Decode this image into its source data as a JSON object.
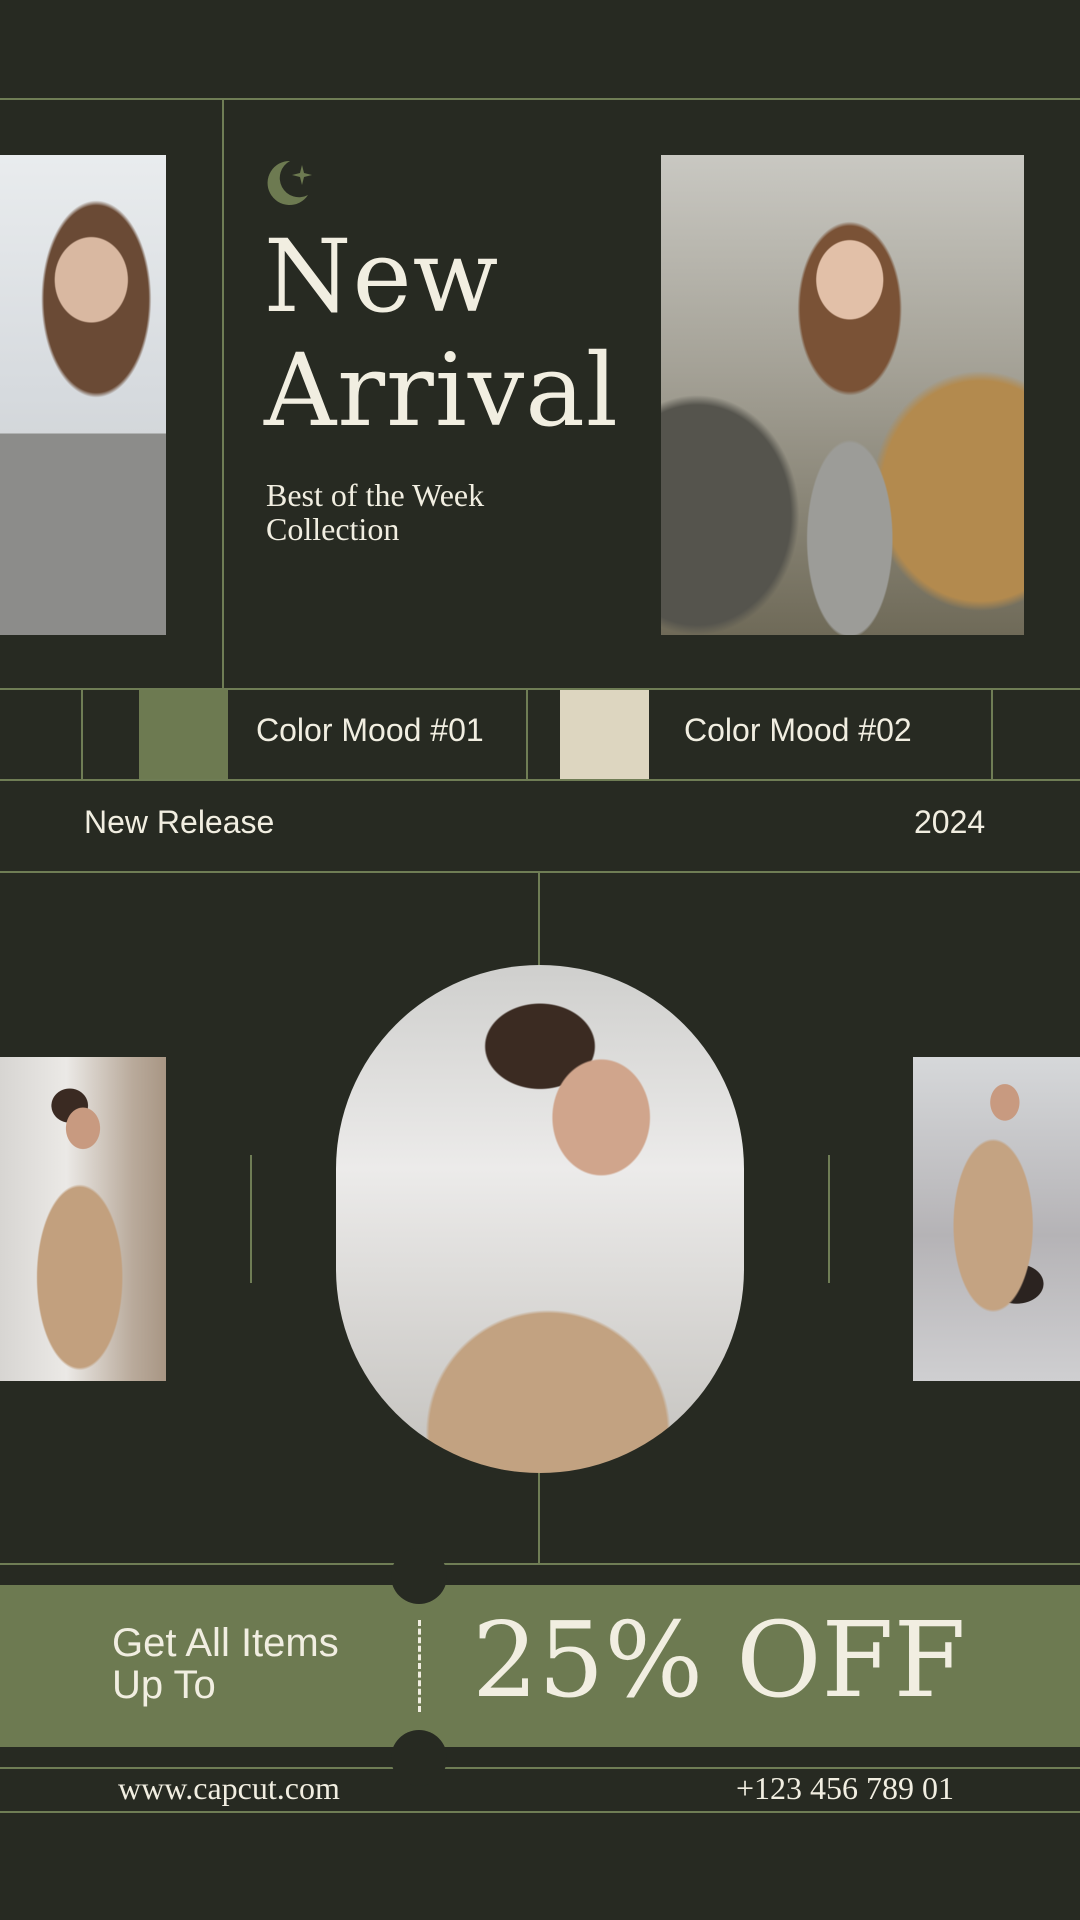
{
  "hero": {
    "title_line1": "New",
    "title_line2": "Arrival",
    "subtitle_line1": "Best of the Week",
    "subtitle_line2": "Collection",
    "logo_icon": "moon-star-icon"
  },
  "color_moods": [
    {
      "label": "Color Mood #01",
      "swatch": "#6d7a51"
    },
    {
      "label": "Color Mood #02",
      "swatch": "#ddd6c0"
    }
  ],
  "release": {
    "label": "New Release",
    "year": "2024"
  },
  "promo": {
    "line1": "Get All Items",
    "line2": "Up To",
    "discount": "25% OFF"
  },
  "footer": {
    "website": "www.capcut.com",
    "phone": "+123 456 789 01"
  },
  "colors": {
    "background": "#272a22",
    "accent": "#6d7a51",
    "cream": "#f1eee1",
    "line": "#6f7d55"
  }
}
